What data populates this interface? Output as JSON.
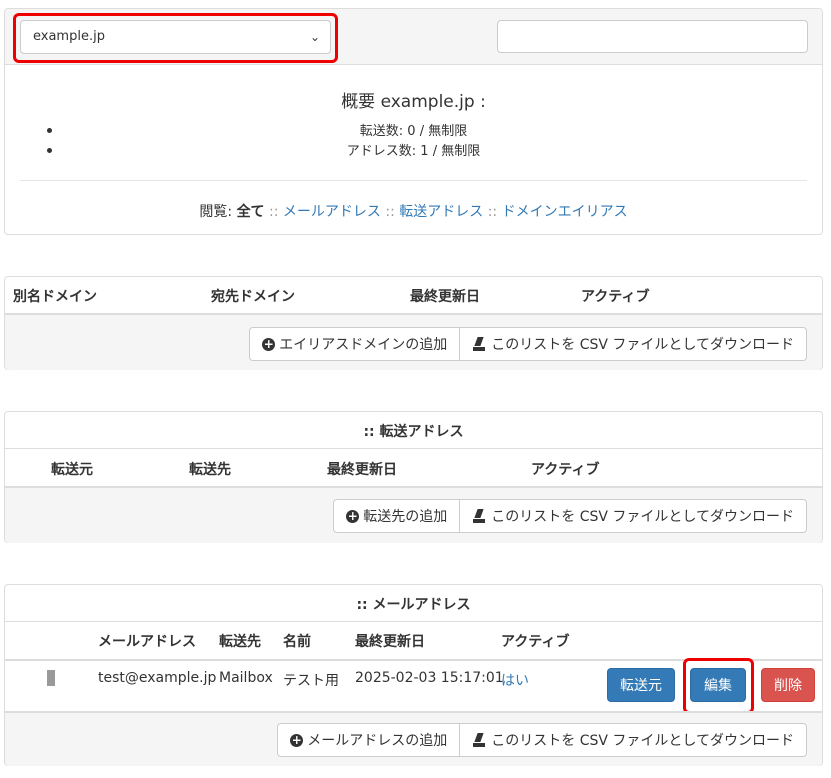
{
  "domain_select": {
    "value": "example.jp"
  },
  "overview": {
    "title": "概要 example.jp :",
    "forwards_count": "転送数: 0 / 無制限",
    "address_count": "アドレス数: 1 / 無制限",
    "browse_label": "閲覧:",
    "browse_all": "全て",
    "sep": "::",
    "link_mail": "メールアドレス",
    "link_forward": "転送アドレス",
    "link_alias": "ドメインエイリアス"
  },
  "alias_domain": {
    "headers": [
      "別名ドメイン",
      "宛先ドメイン",
      "最終更新日",
      "アクティブ"
    ],
    "add_button": "エイリアスドメインの追加",
    "csv_button": "このリストを CSV ファイルとしてダウンロード"
  },
  "forward": {
    "caption": ":: 転送アドレス",
    "headers": [
      "転送元",
      "転送先",
      "最終更新日",
      "アクティブ"
    ],
    "add_button": "転送先の追加",
    "csv_button": "このリストを CSV ファイルとしてダウンロード"
  },
  "mail": {
    "caption": ":: メールアドレス",
    "headers": [
      "メールアドレス",
      "転送先",
      "名前",
      "最終更新日",
      "アクティブ"
    ],
    "row": {
      "address": "test@example.jp",
      "forward": "Mailbox",
      "name": "テスト用",
      "updated": "2025-02-03 15:17:01",
      "active": "はい"
    },
    "btn_forward": "転送元",
    "btn_edit": "編集",
    "btn_delete": "削除",
    "add_button": "メールアドレスの追加",
    "csv_button": "このリストを CSV ファイルとしてダウンロード"
  },
  "colors": {
    "primary": "#337ab7",
    "danger": "#d9534f",
    "highlight": "#e00000"
  },
  "icons": [
    "chevron-down-icon",
    "plus-circle-icon",
    "download-icon"
  ]
}
